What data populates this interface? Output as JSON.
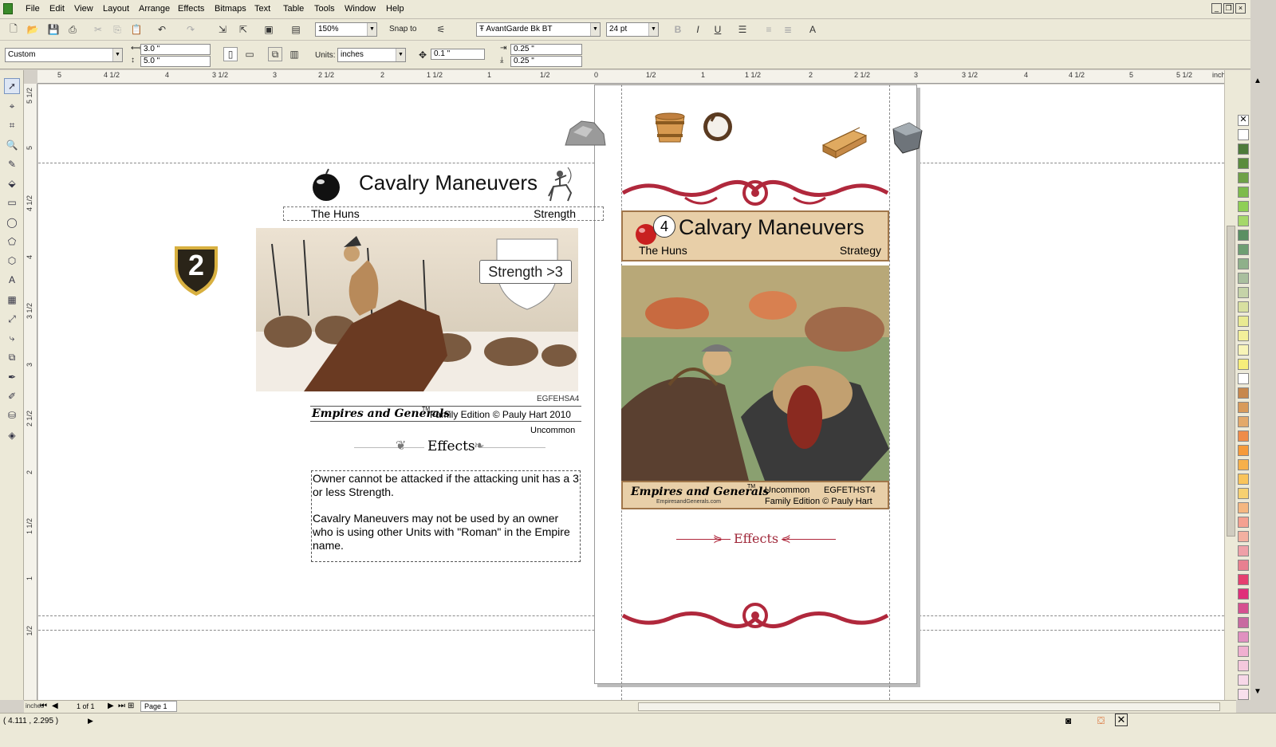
{
  "menu": [
    "File",
    "Edit",
    "View",
    "Layout",
    "Arrange",
    "Effects",
    "Bitmaps",
    "Text",
    "Table",
    "Tools",
    "Window",
    "Help"
  ],
  "toolbar1": {
    "zoom": "150%",
    "snap_to": "Snap to",
    "font": "AvantGarde Bk BT",
    "font_size": "24 pt"
  },
  "toolbar2": {
    "page_preset": "Custom",
    "width": "3.0 \"",
    "height": "5.0 \"",
    "units_label": "Units:",
    "units": "inches",
    "nudge": "0.1 \"",
    "dup_x": "0.25 \"",
    "dup_y": "0.25 \""
  },
  "ruler": {
    "units": "inches",
    "h_ticks": [
      "5",
      "4 1/2",
      "4",
      "3 1/2",
      "3",
      "2 1/2",
      "2",
      "1 1/2",
      "1",
      "1/2",
      "0",
      "1/2",
      "1",
      "1 1/2",
      "2",
      "2 1/2",
      "3",
      "3 1/2",
      "4",
      "4 1/2",
      "5",
      "5 1/2"
    ],
    "v_ticks": [
      "5 1/2",
      "5",
      "4 1/2",
      "4",
      "3 1/2",
      "3",
      "2 1/2",
      "2",
      "1 1/2",
      "1",
      "1/2"
    ]
  },
  "left_card": {
    "title": "Cavalry Maneuvers",
    "empire": "The Huns",
    "type": "Strength",
    "badge_number": "2",
    "strength_label": "Strength >3",
    "code": "EGFEHSA4",
    "brand": "Empires and Generals",
    "trademark": "TM",
    "edition": "Family Edition  © Pauly Hart 2010",
    "rarity": "Uncommon",
    "effects_heading": "Effects",
    "effect_text_1": "Owner cannot be attacked if the attacking unit has a 3 or less Strength.",
    "effect_text_2": "Cavalry Maneuvers may not be used by an owner who is using other Units with \"Roman\" in the Empire name."
  },
  "right_card": {
    "cost": "4",
    "title": "Calvary Maneuvers",
    "empire": "The Huns",
    "type": "Strategy",
    "brand": "Empires and Generals",
    "trademark": "TM",
    "website": "EmpiresandGenerals.com",
    "rarity": "Uncommon",
    "code": "EGFETHST4",
    "edition": "Family Edition © Pauly Hart",
    "effects_heading": "Effects"
  },
  "navigator": {
    "page_count": "1 of 1",
    "page_tab": "Page 1"
  },
  "status": {
    "coords": "( 4.111 , 2.295 )"
  },
  "colors": {
    "chrome": "#ece9d8",
    "accent_red": "#b0283c",
    "parchment": "#e8cfa8",
    "shield_dark": "#2a2418",
    "gold": "#d8b040"
  },
  "palette": [
    "#ffffff",
    "#4d7a3a",
    "#5b8c3d",
    "#6fa146",
    "#7dbb4b",
    "#8fcf55",
    "#a5d86a",
    "#5a8f62",
    "#6e9e72",
    "#8fb08a",
    "#a9bf9e",
    "#c5d3a8",
    "#d8e0a0",
    "#e9ea92",
    "#f3f09a",
    "#f8f4b8",
    "#f7ee7a",
    "#ffffff",
    "#c7874c",
    "#d89a5a",
    "#e3a96a",
    "#ef8c4a",
    "#f59a3a",
    "#f7b04a",
    "#f9c45a",
    "#f6d070",
    "#f5b780",
    "#f4a090",
    "#f3b0a0",
    "#efa0a8",
    "#e88090",
    "#e54070",
    "#e0307a",
    "#d65090",
    "#c86aa0",
    "#e090c0",
    "#f0b0d0",
    "#f5c8dc",
    "#f7d8e8",
    "#f8e0ec"
  ]
}
